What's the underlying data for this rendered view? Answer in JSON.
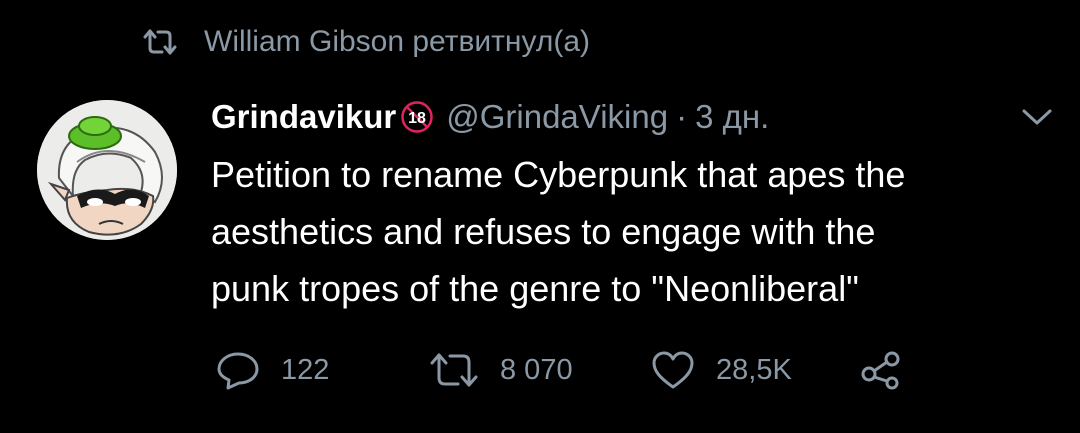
{
  "retweet": {
    "text": "William Gibson ретвитнул(а)"
  },
  "author": {
    "display_name": "Grindavikur",
    "handle": "@GrindaViking",
    "separator": "·",
    "time": "3 дн."
  },
  "tweet": {
    "lines": [
      "Petition to rename Cyberpunk that apes the",
      "aesthetics and refuses to engage with the",
      "punk tropes of the genre to \"Neonliberal\""
    ]
  },
  "actions": {
    "reply_count": "122",
    "retweet_count": "8 070",
    "like_count": "28,5K"
  },
  "colors": {
    "background": "#000000",
    "primary_text": "#ffffff",
    "secondary_text": "#8b98a5",
    "age_badge": "#e0245e"
  },
  "icons": {
    "retweet_header": "retweet-icon",
    "age_badge": "age-18-icon",
    "menu": "chevron-down-icon",
    "reply": "reply-bubble-icon",
    "retweet": "retweet-icon",
    "like": "heart-icon",
    "share": "share-icon"
  }
}
